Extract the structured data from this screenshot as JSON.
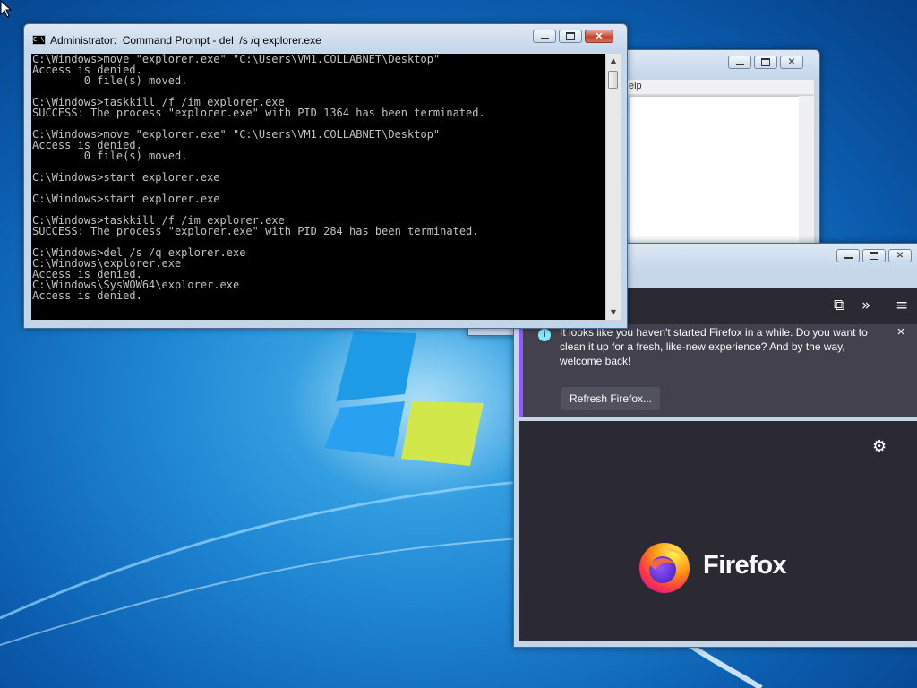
{
  "desktop": {
    "accent": "#1f86d3"
  },
  "cmd_window": {
    "title": "Administrator:  Command Prompt - del  /s /q explorer.exe",
    "icon_label": "C:\\",
    "lines": [
      "C:\\Windows>move \"explorer.exe\" \"C:\\Users\\VM1.COLLABNET\\Desktop\"",
      "Access is denied.",
      "        0 file(s) moved.",
      "",
      "C:\\Windows>taskkill /f /im explorer.exe",
      "SUCCESS: The process \"explorer.exe\" with PID 1364 has been terminated.",
      "",
      "C:\\Windows>move \"explorer.exe\" \"C:\\Users\\VM1.COLLABNET\\Desktop\"",
      "Access is denied.",
      "        0 file(s) moved.",
      "",
      "C:\\Windows>start explorer.exe",
      "",
      "C:\\Windows>start explorer.exe",
      "",
      "C:\\Windows>taskkill /f /im explorer.exe",
      "SUCCESS: The process \"explorer.exe\" with PID 284 has been terminated.",
      "",
      "C:\\Windows>del /s /q explorer.exe",
      "C:\\Windows\\explorer.exe",
      "Access is denied.",
      "C:\\Windows\\SysWOW64\\explorer.exe",
      "Access is denied."
    ]
  },
  "back_window": {
    "menu_fragment": "elp"
  },
  "firefox": {
    "notice_text": "It looks like you haven't started Firefox in a while. Do you want to clean it up for a fresh, like-new experience? And by the way, welcome back!",
    "refresh_button": "Refresh Firefox...",
    "notice_close": "×",
    "wordmark": "Firefox",
    "brand_color": "#9059ff",
    "toolbar_icons": [
      "extensions-icon",
      "overflow-chevrons-icon",
      "hamburger-menu-icon"
    ]
  }
}
